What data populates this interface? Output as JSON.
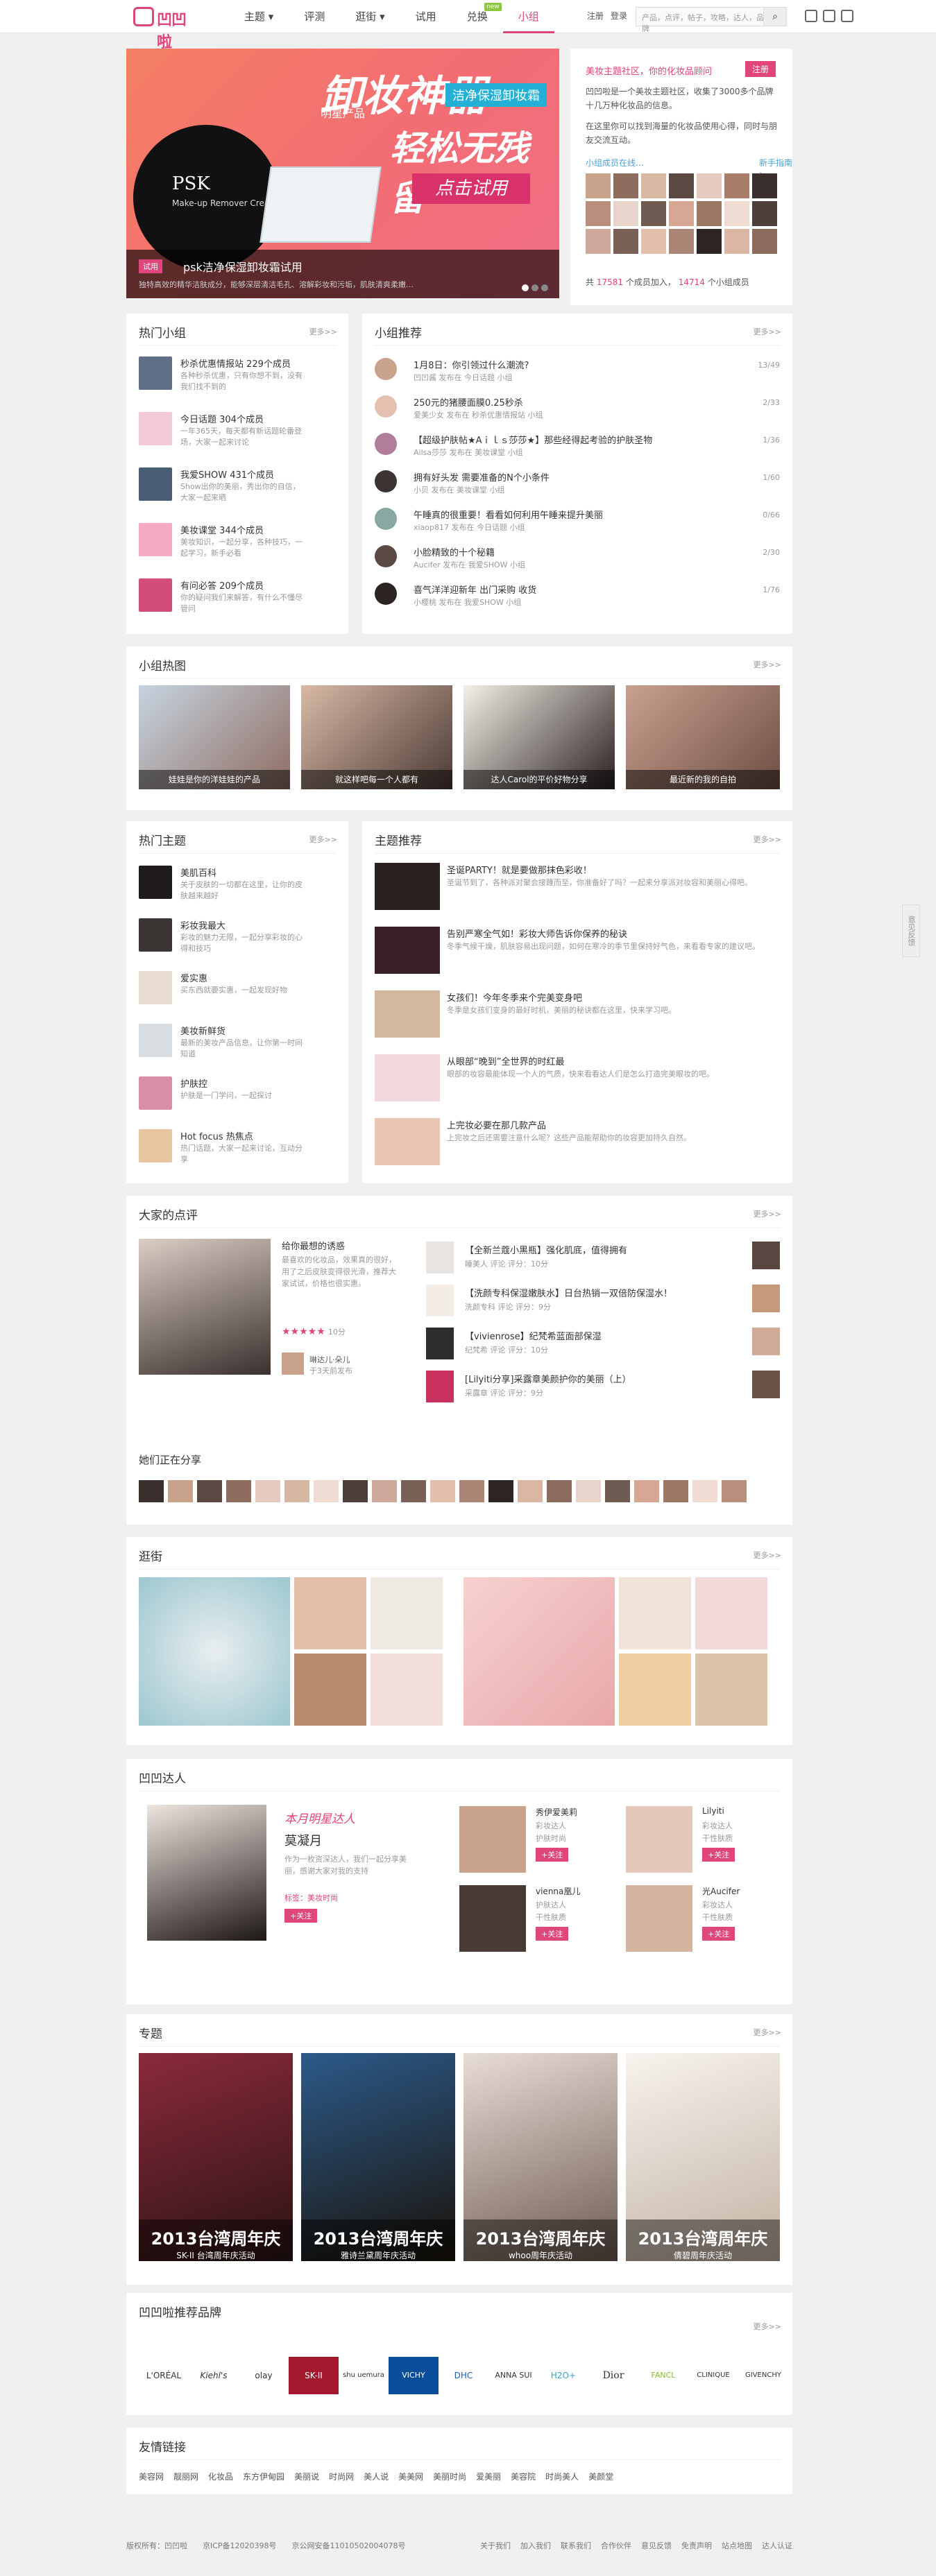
{
  "logo_text": "凹凹啦",
  "nav": [
    {
      "label": "主题",
      "has_menu": true
    },
    {
      "label": "评测"
    },
    {
      "label": "逛街",
      "has_menu": true
    },
    {
      "label": "试用"
    },
    {
      "label": "兑换",
      "badge": "new"
    },
    {
      "label": "小组",
      "active": true
    }
  ],
  "toplinks": [
    "注册",
    "登录"
  ],
  "search_placeholder": "产品，点评，帖子，攻略，达人，品牌",
  "banner": {
    "h1": "卸妆神器",
    "h2": "轻松无残留",
    "tag": "洁净保湿卸妆霜",
    "tag2": "明星产品",
    "brand": "PSK",
    "brand_sub": "Make-up Remover Cream",
    "cta": "点击试用",
    "cap_label": "试用",
    "cap_title": "psk洁净保湿卸妆霜试用",
    "cap_desc": "独特高效的精华洁肤成分，能够深层清洁毛孔、溶解彩妆和污垢，肌肤清爽柔嫩…"
  },
  "intro": {
    "title": "美妆主题社区，你的化妆品顾问",
    "register": "注册",
    "p1": "凹凹啦是一个美妆主题社区，收集了3000多个品牌十几万种化妆品的信息。",
    "p2": "在这里你可以找到海量的化妆品使用心得，同时与朋友交流互动。",
    "greet": "小组成员在线…",
    "welcome": "新手指南 ›",
    "stat_pre": "共",
    "members": "17581",
    "stat_mid": "个成员加入，",
    "online": "14714",
    "stat_post": "个小组成员"
  },
  "hot_groups": {
    "title": "热门小组",
    "more": "更多>>",
    "items": [
      {
        "name": "秒杀优惠情报站 229个成员",
        "desc": "各种秒杀优惠，只有你想不到，没有我们找不到的"
      },
      {
        "name": "今日话题 304个成员",
        "desc": "一年365天，每天都有新话题轮番登场，大家一起来讨论"
      },
      {
        "name": "我爱SHOW 431个成员",
        "desc": "Show出你的美丽，秀出你的自信，大家一起来晒"
      },
      {
        "name": "美妆课堂 344个成员",
        "desc": "美妆知识，一起分享，各种技巧，一起学习，新手必看"
      },
      {
        "name": "有问必答 209个成员",
        "desc": "你的疑问我们来解答，有什么不懂尽管问"
      }
    ]
  },
  "group_recs": {
    "title": "小组推荐",
    "more": "更多>>",
    "items": [
      {
        "title": "1月8日：你引领过什么潮流?",
        "meta": "凹凹酱 发布在 今日话题 小组",
        "count": "13/49"
      },
      {
        "title": "250元的猪腰面膜0.25秒杀",
        "meta": "爱美少女 发布在 秒杀优惠情报站 小组",
        "count": "2/33"
      },
      {
        "title": "【超级护肤帖★Aｉｌｓ莎莎★】那些经得起考验的护肤圣物",
        "meta": "Ailsa莎莎 发布在 美妆课堂 小组",
        "count": "1/36"
      },
      {
        "title": "拥有好头发 需要准备的N个小条件",
        "meta": "小贝 发布在 美妆课堂 小组",
        "count": "1/60"
      },
      {
        "title": "午睡真的很重要！看看如何利用午睡来提升美丽",
        "meta": "xiaop817 发布在 今日话题 小组",
        "count": "0/66"
      },
      {
        "title": "小脸精致的十个秘籍",
        "meta": "Aucifer 发布在 我爱SHOW 小组",
        "count": "2/30"
      },
      {
        "title": "喜气洋洋迎新年 出门采购 收货",
        "meta": "小樱桃 发布在 我爱SHOW 小组",
        "count": "1/76"
      }
    ]
  },
  "group_photos": {
    "title": "小组热图",
    "more": "更多>>",
    "items": [
      "娃娃是你的洋娃娃的产品",
      "就这样吧每一个人都有",
      "达人Carol的平价好物分享",
      "最近新的我的自拍"
    ]
  },
  "hot_topics": {
    "title": "热门主题",
    "more": "更多>>",
    "items": [
      {
        "name": "美肌百科",
        "desc": "关于皮肤的一切都在这里，让你的皮肤越来越好"
      },
      {
        "name": "彩妆我最大",
        "desc": "彩妆的魅力无限，一起分享彩妆的心得和技巧"
      },
      {
        "name": "爱实惠",
        "desc": "买东西就要实惠，一起发现好物"
      },
      {
        "name": "美妆新鲜货",
        "desc": "最新的美妆产品信息，让你第一时间知道"
      },
      {
        "name": "护肤控",
        "desc": "护肤是一门学问，一起探讨"
      },
      {
        "name": "Hot focus 热焦点",
        "desc": "热门话题，大家一起来讨论，互动分享"
      }
    ]
  },
  "topic_recs": {
    "title": "主题推荐",
    "more": "更多>>",
    "items": [
      {
        "title": "圣诞PARTY！就是要做那抹色彩收！",
        "desc": "圣诞节到了，各种派对聚会接踵而至，你准备好了吗？一起来分享派对妆容和美丽心得吧。"
      },
      {
        "title": "告别严寒全气如！彩妆大师告诉你保养的秘诀",
        "desc": "冬季气候干燥，肌肤容易出现问题，如何在寒冷的季节里保持好气色，来看看专家的建议吧。"
      },
      {
        "title": "女孩们！今年冬季来个完美变身吧",
        "desc": "冬季是女孩们变身的最好时机，美丽的秘诀都在这里，快来学习吧。"
      },
      {
        "title": "从眼部“晚到”全世界的时红最",
        "desc": "眼部的妆容最能体现一个人的气质，快来看看达人们是怎么打造完美眼妆的吧。"
      },
      {
        "title": "上完妆必要在那几款产品",
        "desc": "上完妆之后还需要注意什么呢？这些产品能帮助你的妆容更加持久自然。"
      }
    ]
  },
  "reviews": {
    "title": "大家的点评",
    "more": "更多>>",
    "featured_title": "给你最想的诱惑",
    "featured_desc": "最喜欢的化妆品，效果真的很好，用了之后皮肤变得很光滑，推荐大家试试，价格也很实惠。",
    "featured_score": "10分",
    "featured_user": "琳达儿·朵儿",
    "featured_user_meta": "于3天前发布",
    "items": [
      {
        "title": "【全新兰蔻小黑瓶】强化肌底，值得拥有",
        "meta": "睡美人 评论 评分：10分"
      },
      {
        "title": "【洗颜专科保湿嫩肤水】日台热销一双倍防保湿水！",
        "meta": "洗颜专科 评论 评分：9分"
      },
      {
        "title": "【vivienrose】纪梵希蓝面部保湿",
        "meta": "纪梵希 评论 评分：10分"
      },
      {
        "title": "[Lilyiti分享]采露章美颜护你的美丽（上）",
        "meta": "采露章 评论 评分：9分"
      }
    ]
  },
  "sharing": {
    "title": "她们正在分享"
  },
  "shopping": {
    "title": "逛街",
    "more": "更多>>"
  },
  "experts": {
    "title": "凹凹达人",
    "month_label": "本月明星达人",
    "star_name": "莫凝月",
    "star_desc": "作为一枚资深达人，我们一起分享美丽，感谢大家对我的支持",
    "star_tag": "标签：美妆时尚",
    "follow": "+关注",
    "list": [
      {
        "name": "秀伊爱美莉",
        "role": "彩妆达人",
        "tag": "护肤时尚"
      },
      {
        "name": "Lilyiti",
        "role": "彩妆达人",
        "tag": "干性肤质"
      },
      {
        "name": "vienna凰儿",
        "role": "护肤达人",
        "tag": "干性肤质"
      },
      {
        "name": "光Aucifer",
        "role": "彩妆达人",
        "tag": "干性肤质"
      }
    ]
  },
  "special": {
    "title": "专题",
    "more": "更多>>",
    "items": [
      {
        "year": "2013台湾周年庆",
        "sub": "SK-II 台湾周年庆活动"
      },
      {
        "year": "2013台湾周年庆",
        "sub": "雅诗兰黛周年庆活动"
      },
      {
        "year": "2013台湾周年庆",
        "sub": "whoo周年庆活动"
      },
      {
        "year": "2013台湾周年庆",
        "sub": "倩碧周年庆活动"
      }
    ]
  },
  "brands": {
    "title": "凹凹啦推荐品牌",
    "more": "更多>>",
    "items": [
      "L'ORÉAL",
      "Kiehl's",
      "olay",
      "SK-II",
      "shu uemura",
      "VICHY",
      "DHC",
      "ANNA SUI",
      "H2O+",
      "Dior",
      "FANCL",
      "CLINIQUE",
      "GIVENCHY"
    ]
  },
  "friend_links": {
    "title": "友情链接",
    "items": [
      "美容网",
      "靓丽网",
      "化妆品",
      "东方伊甸园",
      "美丽说",
      "时尚网",
      "美人说",
      "美美网",
      "美丽时尚",
      "爱美丽",
      "美容院",
      "时尚美人",
      "美颜堂"
    ]
  },
  "footer": {
    "left": "版权所有：凹凹啦　　京ICP备12020398号　　京公网安备11010502004078号",
    "links": [
      "关于我们",
      "加入我们",
      "联系我们",
      "合作伙伴",
      "意见反馈",
      "免责声明",
      "站点地图",
      "达人认证"
    ]
  },
  "side_feedback": "意见反馈"
}
